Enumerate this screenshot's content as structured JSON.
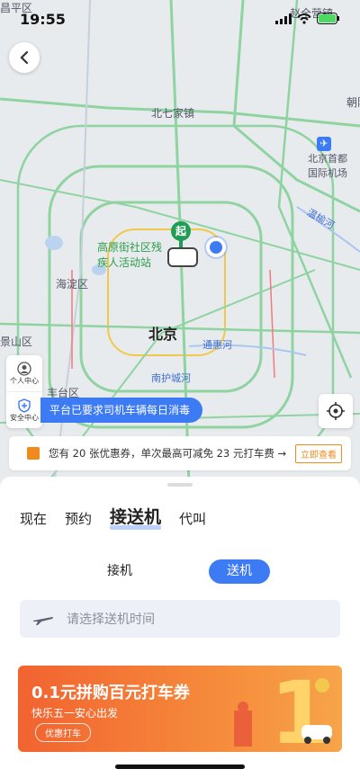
{
  "status": {
    "time": "19:55"
  },
  "map": {
    "labels": {
      "north_seven": "北七家镇",
      "zhao_quan_ying": "赵全营镇",
      "airport": "北京首都\n国际机场",
      "wenyu_river": "温榆河",
      "gaoyuan": "高原街社区残\n疾人活动站",
      "haidian": "海淀区",
      "beijing": "北京",
      "tonghui_river": "通惠河",
      "jingshan": "景山区",
      "fengtai": "丰台区",
      "nanhu": "南护城河",
      "chaoyang": "朝阳",
      "changping": "昌平区",
      "start_marker": "起"
    }
  },
  "side": {
    "personal": "个人中心",
    "safety": "安全中心"
  },
  "banner": "平台已要求司机车辆每日消毒",
  "coupon": {
    "text": "您有 20 张优惠券，单次最高可减免 23 元打车费 →",
    "action": "立即查看"
  },
  "tabs": [
    "现在",
    "预约",
    "接送机",
    "代叫"
  ],
  "segments": {
    "pickup": "接机",
    "dropoff": "送机"
  },
  "time_field": {
    "placeholder": "请选择送机时间"
  },
  "ad": {
    "title": "0.1元拼购百元打车券",
    "subtitle": "快乐五一安心出发",
    "cta": "优惠打车"
  },
  "colors": {
    "accent": "#3d7bf5",
    "orange": "#f08a1c"
  }
}
